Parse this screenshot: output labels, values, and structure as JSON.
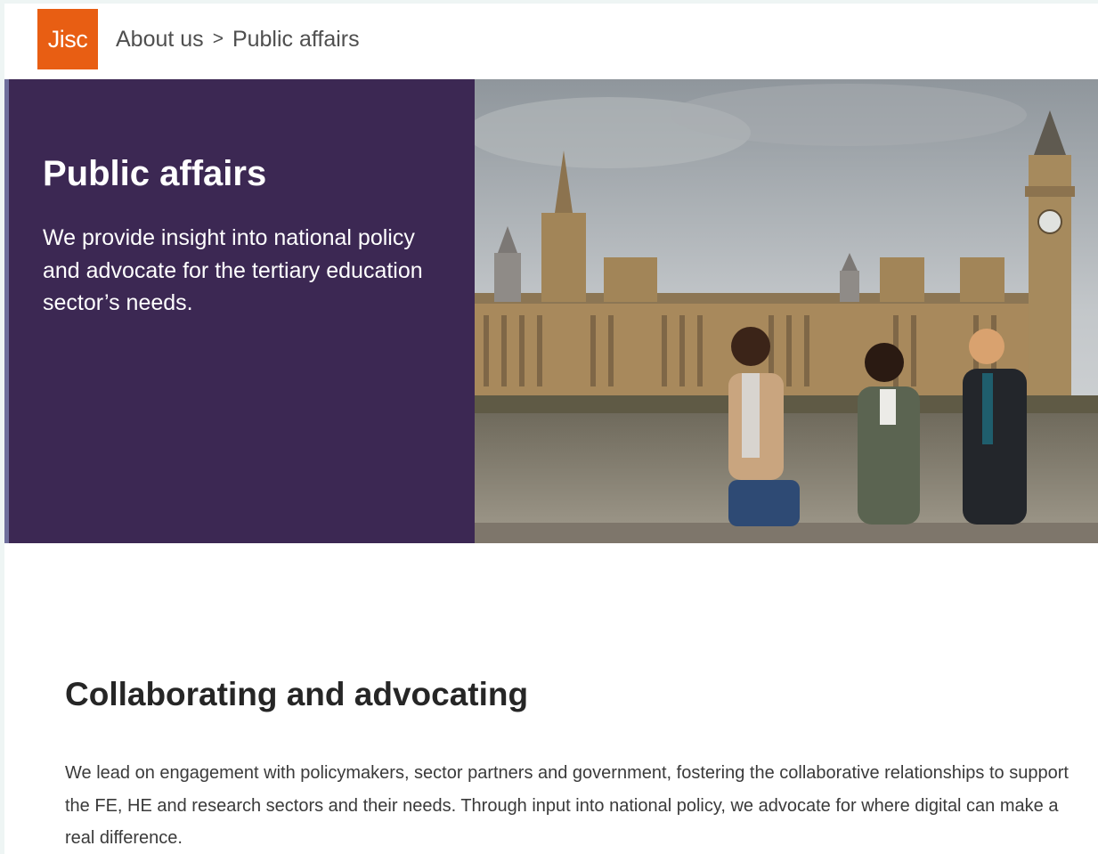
{
  "header": {
    "logo_text": "Jisc",
    "breadcrumb": [
      {
        "label": "About us"
      },
      {
        "label": "Public affairs"
      }
    ],
    "separator": ">"
  },
  "hero": {
    "title": "Public affairs",
    "subtitle": "We provide insight into national policy and advocate for the tertiary education sector’s needs.",
    "image_alt": "Three students sitting by the river in front of the Houses of Parliament"
  },
  "section": {
    "title": "Collaborating and advocating",
    "body": "We lead on engagement with policymakers, sector partners and government, fostering the collaborative relationships to support the FE, HE and research sectors and their needs. Through input into national policy, we advocate for where digital can make a real difference."
  },
  "colors": {
    "brand_orange": "#e85e13",
    "hero_purple": "#3c2853",
    "page_bg": "#ffffff"
  }
}
